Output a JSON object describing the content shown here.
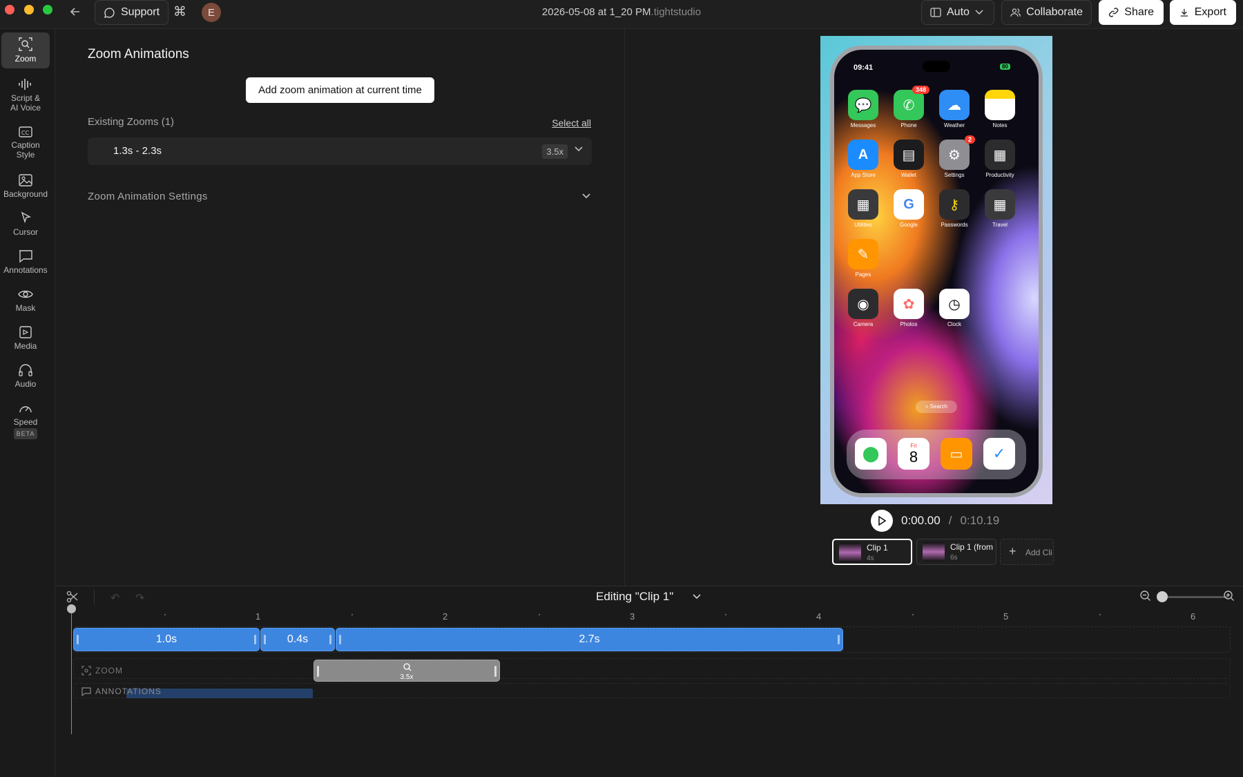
{
  "window": {
    "title": "2026-05-08 at 1_20 PM",
    "title_ext": ".tightstudio",
    "traffic_colors": [
      "#ff5f57",
      "#febc2e",
      "#28c840"
    ]
  },
  "header": {
    "support_label": "Support",
    "avatar_initial": "E",
    "layout_label": "Auto",
    "collaborate_label": "Collaborate",
    "share_label": "Share",
    "export_label": "Export"
  },
  "sidebar": {
    "items": [
      {
        "label": "Zoom",
        "icon": "zoom-icon"
      },
      {
        "label": "Script &",
        "label2": "AI Voice",
        "icon": "waveform-icon"
      },
      {
        "label": "Caption",
        "label2": "Style",
        "icon": "caption-icon"
      },
      {
        "label": "Background",
        "icon": "image-icon"
      },
      {
        "label": "Cursor",
        "icon": "cursor-icon"
      },
      {
        "label": "Annotations",
        "icon": "speech-bubble-icon"
      },
      {
        "label": "Mask",
        "icon": "eye-icon"
      },
      {
        "label": "Media",
        "icon": "media-icon"
      },
      {
        "label": "Audio",
        "icon": "headphones-icon"
      },
      {
        "label": "Speed",
        "icon": "gauge-icon",
        "badge": "BETA"
      }
    ]
  },
  "panel": {
    "title": "Zoom Animations",
    "add_button": "Add zoom animation at current time",
    "existing_label": "Existing Zooms (1)",
    "select_all": "Select all",
    "zooms": [
      {
        "range": "1.3s - 2.3s",
        "scale": "3.5x"
      }
    ],
    "settings_label": "Zoom Animation Settings"
  },
  "phone": {
    "time": "09:41",
    "battery": "80",
    "apps": [
      {
        "label": "Messages",
        "color": "#34c759"
      },
      {
        "label": "Phone",
        "color": "#34c759",
        "badge": "348"
      },
      {
        "label": "Weather",
        "color": "#2f8ef5"
      },
      {
        "label": "Notes",
        "color": "#fff7d0"
      },
      {
        "label": "App Store",
        "color": "#1a8cff"
      },
      {
        "label": "Wallet",
        "color": "#1c1c1e"
      },
      {
        "label": "Settings",
        "color": "#8e8e93",
        "badge": "2"
      },
      {
        "label": "Productivity",
        "color": "#2c2c2e"
      },
      {
        "label": "Utilities",
        "color": "#3a3a3c"
      },
      {
        "label": "Google",
        "color": "#ffffff"
      },
      {
        "label": "Passwords",
        "color": "#2c2c2e"
      },
      {
        "label": "Travel",
        "color": "#3a3a3c"
      },
      {
        "label": "Pages",
        "color": "#ff9500"
      },
      {
        "label": "Camera",
        "color": "#2c2c2e"
      },
      {
        "label": "Photos",
        "color": "#ffffff"
      },
      {
        "label": "Clock",
        "color": "#ffffff"
      }
    ],
    "search": "Search",
    "dock_day": "Fri",
    "dock_date": "8"
  },
  "player": {
    "current": "0:00.00",
    "separator": "/",
    "total": "0:10.19"
  },
  "clips": [
    {
      "name": "Clip 1",
      "duration": "4s"
    },
    {
      "name": "Clip 1 (from",
      "duration": "6s"
    },
    {
      "name": "Add Cli"
    }
  ],
  "timeline": {
    "editing_label": "Editing \"Clip 1\"",
    "ticks": [
      "1",
      "2",
      "3",
      "4",
      "5",
      "6"
    ],
    "segments": [
      "1.0s",
      "0.4s",
      "2.7s"
    ],
    "zoom_track_label": "ZOOM",
    "zoom_block_scale": "3.5x",
    "annotations_track_label": "ANNOTATIONS",
    "accent": "#3d86e0"
  }
}
